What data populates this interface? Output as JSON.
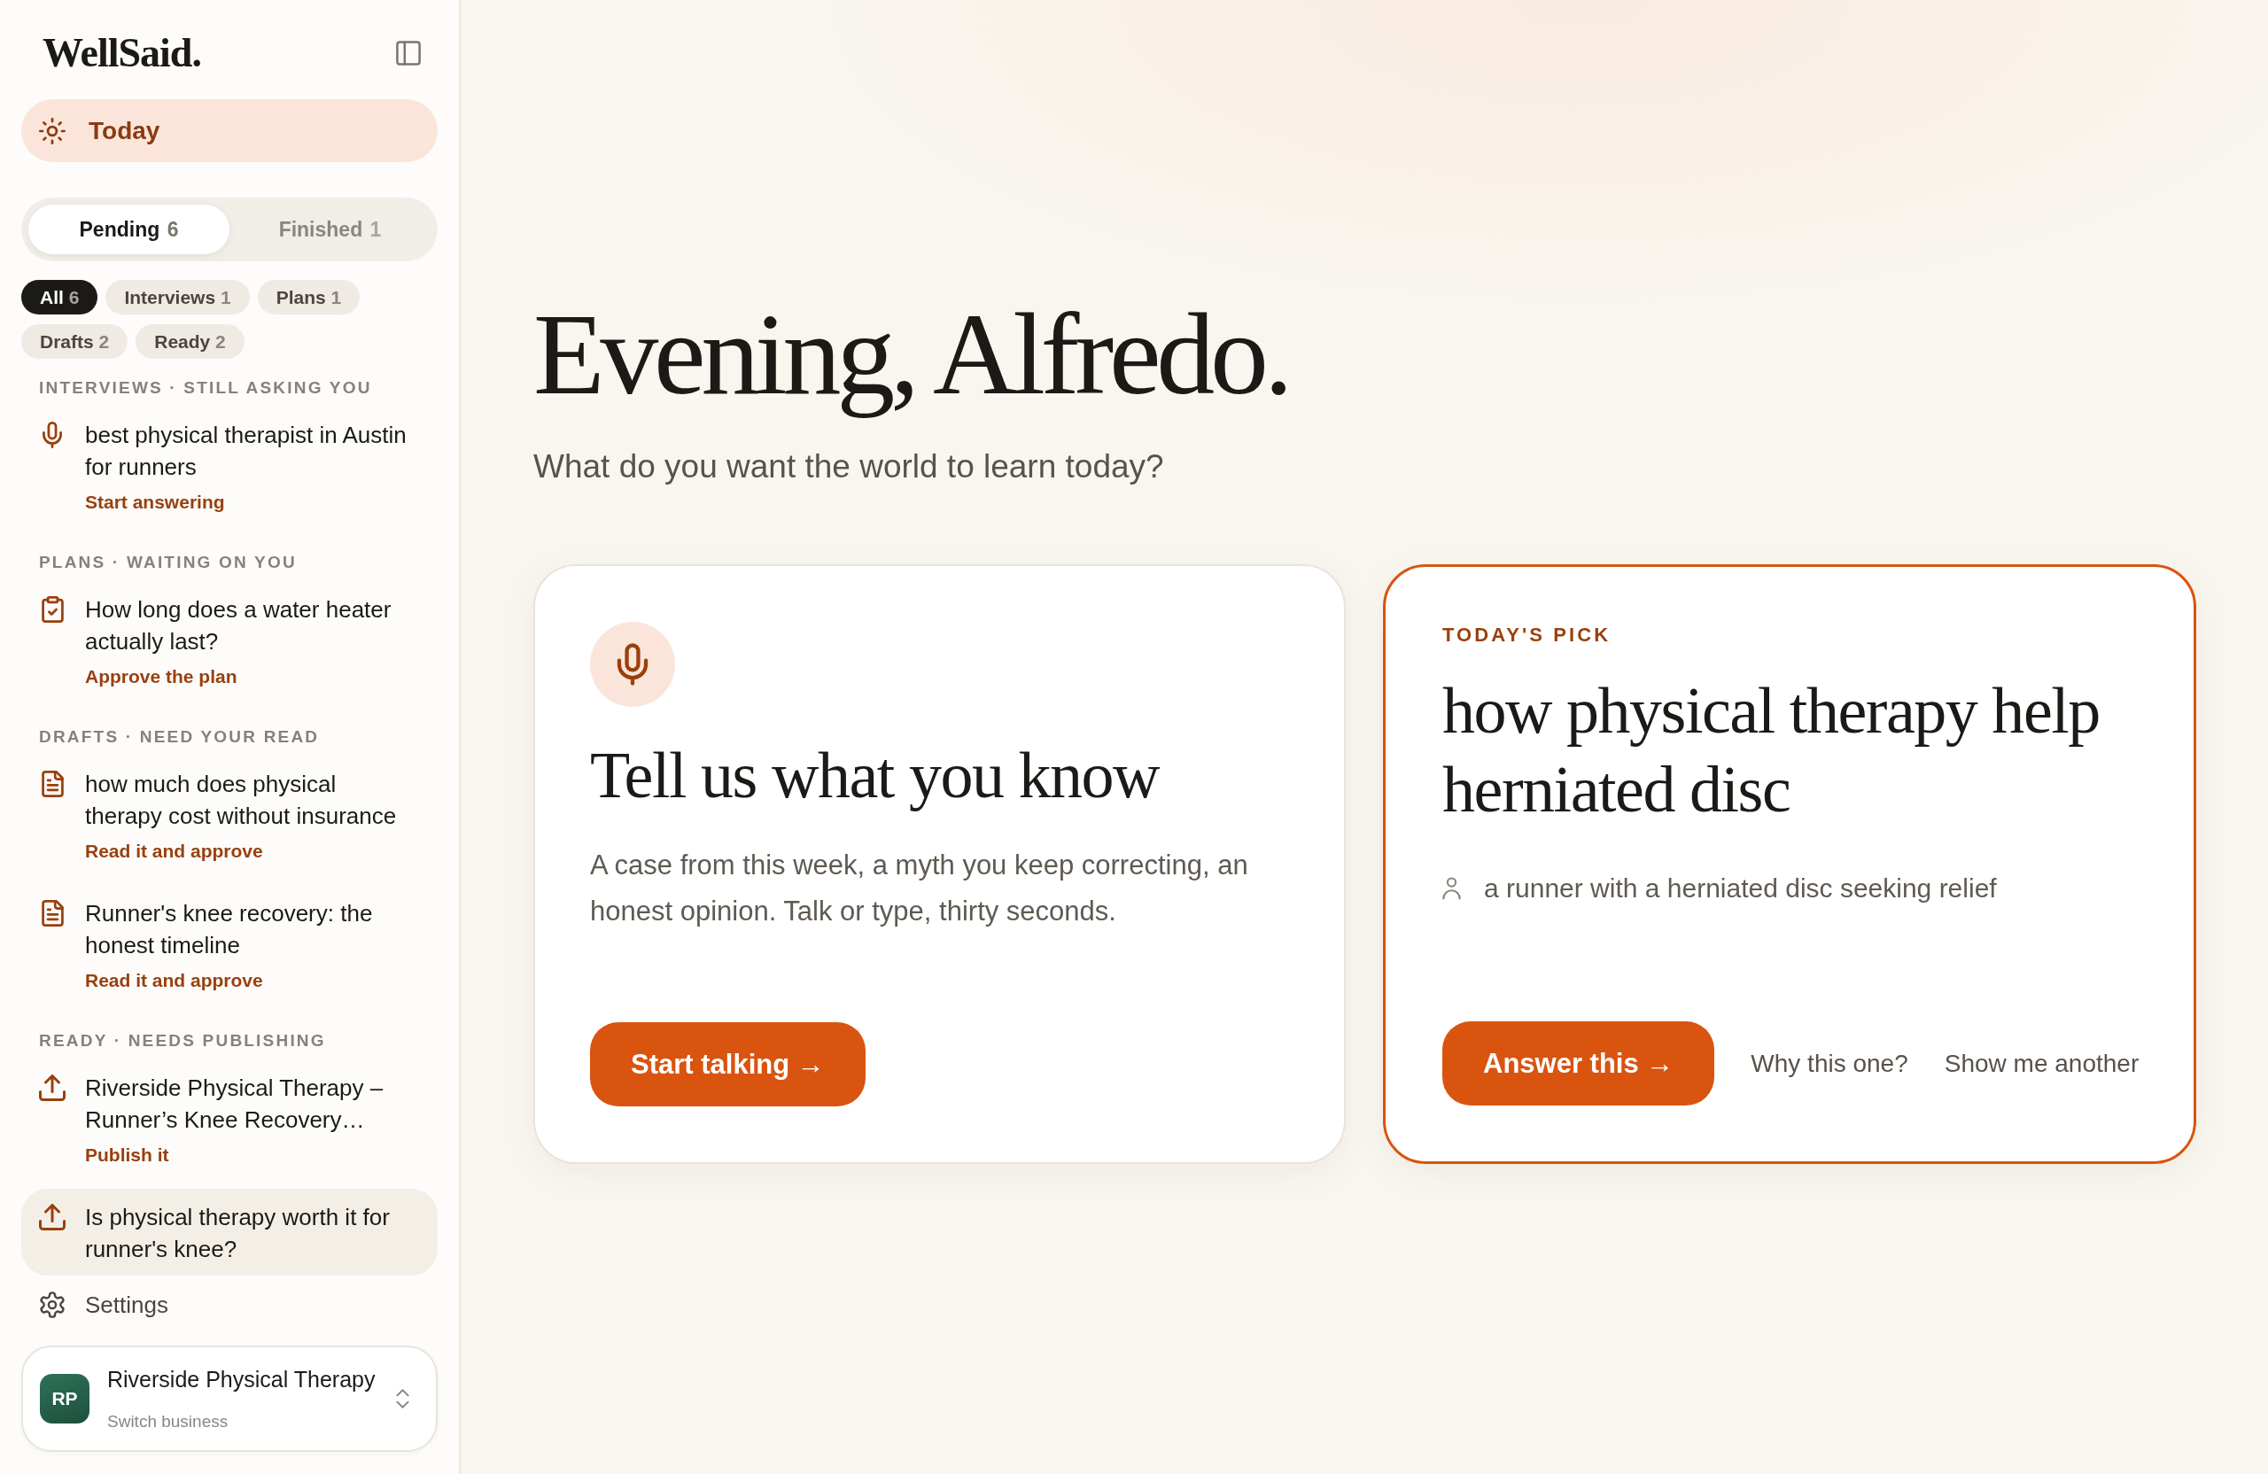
{
  "sidebar": {
    "logo": "WellSaid.",
    "nav": [
      {
        "label": "Today",
        "selected": true
      }
    ],
    "status_tabs": [
      {
        "label": "Pending",
        "count": "6",
        "selected": true
      },
      {
        "label": "Finished",
        "count": "1",
        "selected": false
      }
    ],
    "filters": [
      {
        "label": "All",
        "count": "6",
        "selected": true
      },
      {
        "label": "Interviews",
        "count": "1",
        "selected": false
      },
      {
        "label": "Plans",
        "count": "1",
        "selected": false
      },
      {
        "label": "Drafts",
        "count": "2",
        "selected": false
      },
      {
        "label": "Ready",
        "count": "2",
        "selected": false
      }
    ],
    "sections": [
      {
        "heading": "INTERVIEWS · STILL ASKING YOU",
        "items": [
          {
            "kind": "interview",
            "title": "best physical therapist in Austin for runners",
            "action": "Start answering",
            "selected": false
          }
        ]
      },
      {
        "heading": "PLANS · WAITING ON YOU",
        "items": [
          {
            "kind": "plan",
            "title": "How long does a water heater actually last?",
            "action": "Approve the plan",
            "selected": false
          }
        ]
      },
      {
        "heading": "DRAFTS · NEED YOUR READ",
        "items": [
          {
            "kind": "draft",
            "title": "how much does physical therapy cost without insurance",
            "action": "Read it and approve",
            "selected": false
          },
          {
            "kind": "draft",
            "title": "Runner's knee recovery: the honest timeline",
            "action": "Read it and approve",
            "selected": false
          }
        ]
      },
      {
        "heading": "READY · NEEDS PUBLISHING",
        "items": [
          {
            "kind": "ready",
            "title": "Riverside Physical Therapy – Runner’s Knee Recovery…",
            "action": "Publish it",
            "selected": false
          },
          {
            "kind": "ready",
            "title": "Is physical therapy worth it for runner's knee?",
            "selected": true
          }
        ]
      }
    ],
    "settings": "Settings",
    "business": {
      "initials": "RP",
      "name": "Riverside Physical Therapy",
      "subtitle": "Switch business"
    }
  },
  "main": {
    "greeting": "Evening, Alfredo.",
    "subtitle": "What do you want the world to learn today?",
    "cards": [
      {
        "kind": "prompt",
        "selected": false,
        "title": "Tell us what you know",
        "description": "A case from this week, a myth you keep correcting, an honest opinion. Talk or type, thirty seconds.",
        "button": "Start talking →"
      },
      {
        "kind": "pick",
        "selected": true,
        "eyebrow": "TODAY'S PICK",
        "title": "how physical therapy help herniated disc",
        "persona": "a runner with a herniated disc seeking relief",
        "button": "Answer this →",
        "links": [
          "Why this one?",
          "Show me another"
        ]
      }
    ]
  }
}
